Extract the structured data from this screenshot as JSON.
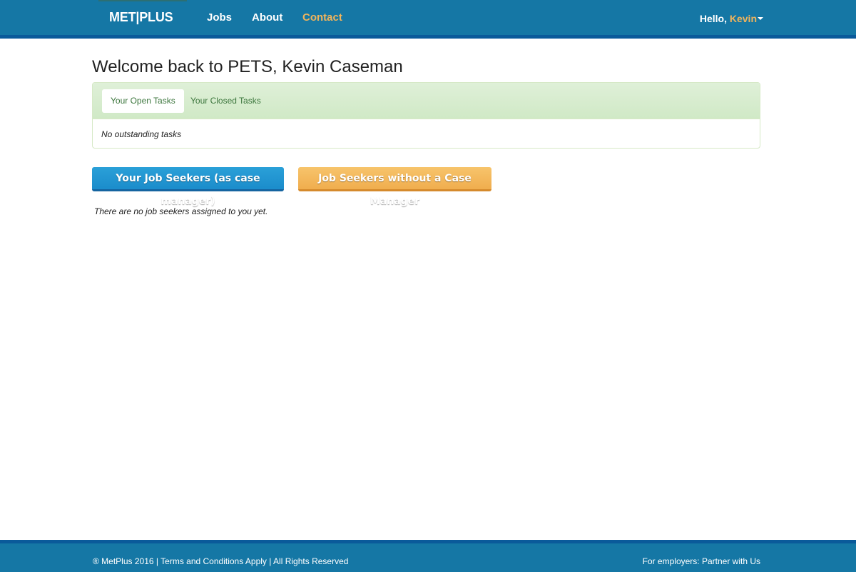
{
  "navbar": {
    "brand": "MET|PLUS",
    "links": [
      {
        "label": "Jobs"
      },
      {
        "label": "About"
      },
      {
        "label": "Contact"
      }
    ],
    "greeting": "Hello,",
    "user_name": "Kevin"
  },
  "main": {
    "title": "Welcome back to PETS, Kevin Caseman",
    "tasks_panel": {
      "tabs": [
        {
          "label": "Your Open Tasks",
          "active": true
        },
        {
          "label": "Your Closed Tasks",
          "active": false
        }
      ],
      "body_text": "No outstanding tasks"
    },
    "buttons": {
      "my_job_seekers": "Your Job Seekers (as case manager)",
      "unassigned_job_seekers": "Job Seekers without a Case Manager"
    },
    "empty_note": "There are no job seekers assigned to you yet."
  },
  "footer": {
    "copyright": "® MetPlus 2016",
    "separator": "|",
    "terms": "Terms and Conditions Apply",
    "rights": "All Rights Reserved",
    "employers_prefix": "For employers:",
    "partner_link": "Partner with Us"
  },
  "colors": {
    "navbar_bg": "#1577a5",
    "accent_orange": "#f0b45c",
    "primary_button": "#1b8ccb",
    "warning_button": "#f0ad4e",
    "panel_success_bg": "#dff0d8"
  }
}
